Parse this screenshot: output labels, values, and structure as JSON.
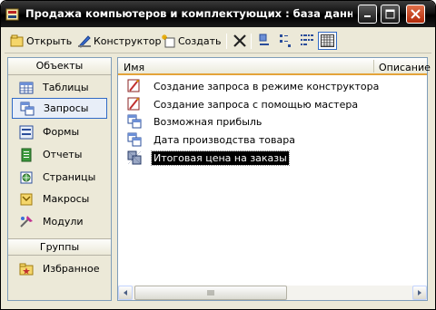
{
  "window": {
    "title": "Продажа компьютеров и комплектующих : база данных (..."
  },
  "toolbar": {
    "open_label": "Открыть",
    "design_label": "Конструктор",
    "create_label": "Создать"
  },
  "objects": {
    "header": "Объекты",
    "items": [
      {
        "label": "Таблицы",
        "icon": "table-icon"
      },
      {
        "label": "Запросы",
        "icon": "query-icon",
        "selected": true
      },
      {
        "label": "Формы",
        "icon": "form-icon"
      },
      {
        "label": "Отчеты",
        "icon": "report-icon"
      },
      {
        "label": "Страницы",
        "icon": "page-icon"
      },
      {
        "label": "Макросы",
        "icon": "macro-icon"
      },
      {
        "label": "Модули",
        "icon": "module-icon"
      }
    ],
    "groups_header": "Группы",
    "groups": [
      {
        "label": "Избранное",
        "icon": "favorites-folder-icon"
      }
    ]
  },
  "list": {
    "columns": [
      "Имя",
      "Описание"
    ],
    "rows": [
      {
        "label": "Создание запроса в режиме конструктора",
        "icon": "wizard-icon"
      },
      {
        "label": "Создание запроса с помощью мастера",
        "icon": "wizard-icon"
      },
      {
        "label": "Возможная прибыль",
        "icon": "query-icon"
      },
      {
        "label": "Дата производства товара",
        "icon": "query-icon"
      },
      {
        "label": "Итоговая цена на заказы",
        "icon": "query-icon",
        "selected": true
      }
    ]
  },
  "colors": {
    "titlebar": "#000000",
    "accent": "#e4a43a",
    "selection": "#000000"
  }
}
